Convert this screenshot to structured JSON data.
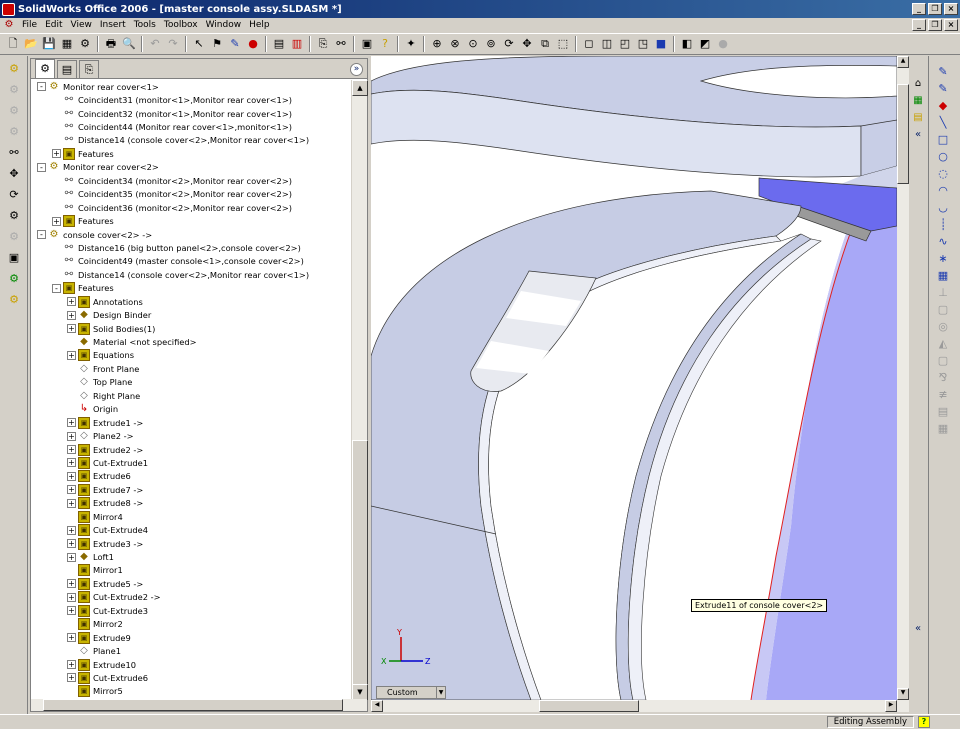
{
  "window": {
    "title": "SolidWorks Office 2006 - [master console assy.SLDASM *]"
  },
  "menu": [
    "File",
    "Edit",
    "View",
    "Insert",
    "Tools",
    "Toolbox",
    "Window",
    "Help"
  ],
  "tree": [
    {
      "label": "Monitor rear cover<1>",
      "indent": 0,
      "expander": "-",
      "icon": "comp"
    },
    {
      "label": "Coincident31 (monitor<1>,Monitor rear cover<1>)",
      "indent": 1,
      "icon": "mate"
    },
    {
      "label": "Coincident32 (monitor<1>,Monitor rear cover<1>)",
      "indent": 1,
      "icon": "mate"
    },
    {
      "label": "Coincident44 (Monitor rear cover<1>,monitor<1>)",
      "indent": 1,
      "icon": "mate"
    },
    {
      "label": "Distance14 (console cover<2>,Monitor rear cover<1>)",
      "indent": 1,
      "icon": "mate"
    },
    {
      "label": "Features",
      "indent": 1,
      "expander": "+",
      "icon": "feat"
    },
    {
      "label": "Monitor rear cover<2>",
      "indent": 0,
      "expander": "-",
      "icon": "comp"
    },
    {
      "label": "Coincident34 (monitor<2>,Monitor rear cover<2>)",
      "indent": 1,
      "icon": "mate"
    },
    {
      "label": "Coincident35 (monitor<2>,Monitor rear cover<2>)",
      "indent": 1,
      "icon": "mate"
    },
    {
      "label": "Coincident36 (monitor<2>,Monitor rear cover<2>)",
      "indent": 1,
      "icon": "mate"
    },
    {
      "label": "Features",
      "indent": 1,
      "expander": "+",
      "icon": "feat"
    },
    {
      "label": "console cover<2> ->",
      "indent": 0,
      "expander": "-",
      "icon": "comp"
    },
    {
      "label": "Distance16 (big button panel<2>,console cover<2>)",
      "indent": 1,
      "icon": "mate"
    },
    {
      "label": "Coincident49 (master console<1>,console cover<2>)",
      "indent": 1,
      "icon": "mate"
    },
    {
      "label": "Distance14 (console cover<2>,Monitor rear cover<1>)",
      "indent": 1,
      "icon": "mate"
    },
    {
      "label": "Features",
      "indent": 1,
      "expander": "-",
      "icon": "feat"
    },
    {
      "label": "Annotations",
      "indent": 2,
      "expander": "+",
      "icon": "feat"
    },
    {
      "label": "Design Binder",
      "indent": 2,
      "expander": "+",
      "icon": "body"
    },
    {
      "label": "Solid Bodies(1)",
      "indent": 2,
      "expander": "+",
      "icon": "feat"
    },
    {
      "label": "Material <not specified>",
      "indent": 2,
      "icon": "body"
    },
    {
      "label": "Equations",
      "indent": 2,
      "expander": "+",
      "icon": "feat"
    },
    {
      "label": "Front Plane",
      "indent": 2,
      "icon": "plane"
    },
    {
      "label": "Top Plane",
      "indent": 2,
      "icon": "plane"
    },
    {
      "label": "Right Plane",
      "indent": 2,
      "icon": "plane"
    },
    {
      "label": "Origin",
      "indent": 2,
      "icon": "origin"
    },
    {
      "label": "Extrude1 ->",
      "indent": 2,
      "expander": "+",
      "icon": "feat"
    },
    {
      "label": "Plane2 ->",
      "indent": 2,
      "expander": "+",
      "icon": "plane"
    },
    {
      "label": "Extrude2 ->",
      "indent": 2,
      "expander": "+",
      "icon": "feat"
    },
    {
      "label": "Cut-Extrude1",
      "indent": 2,
      "expander": "+",
      "icon": "feat"
    },
    {
      "label": "Extrude6",
      "indent": 2,
      "expander": "+",
      "icon": "feat"
    },
    {
      "label": "Extrude7 ->",
      "indent": 2,
      "expander": "+",
      "icon": "feat"
    },
    {
      "label": "Extrude8 ->",
      "indent": 2,
      "expander": "+",
      "icon": "feat"
    },
    {
      "label": "Mirror4",
      "indent": 2,
      "icon": "feat"
    },
    {
      "label": "Cut-Extrude4",
      "indent": 2,
      "expander": "+",
      "icon": "feat"
    },
    {
      "label": "Extrude3 ->",
      "indent": 2,
      "expander": "+",
      "icon": "feat"
    },
    {
      "label": "Loft1",
      "indent": 2,
      "expander": "+",
      "icon": "body"
    },
    {
      "label": "Mirror1",
      "indent": 2,
      "icon": "feat"
    },
    {
      "label": "Extrude5 ->",
      "indent": 2,
      "expander": "+",
      "icon": "feat"
    },
    {
      "label": "Cut-Extrude2 ->",
      "indent": 2,
      "expander": "+",
      "icon": "feat"
    },
    {
      "label": "Cut-Extrude3",
      "indent": 2,
      "expander": "+",
      "icon": "feat"
    },
    {
      "label": "Mirror2",
      "indent": 2,
      "icon": "feat"
    },
    {
      "label": "Extrude9",
      "indent": 2,
      "expander": "+",
      "icon": "feat"
    },
    {
      "label": "Plane1",
      "indent": 2,
      "icon": "plane"
    },
    {
      "label": "Extrude10",
      "indent": 2,
      "expander": "+",
      "icon": "feat"
    },
    {
      "label": "Cut-Extrude6",
      "indent": 2,
      "expander": "+",
      "icon": "feat"
    },
    {
      "label": "Mirror5",
      "indent": 2,
      "icon": "feat"
    }
  ],
  "graphics": {
    "tooltip": "Extrude11 of console cover<2>",
    "view_tab": "Custom",
    "triad": {
      "x_label": "X",
      "y_label": "Y",
      "z_label": "Z"
    }
  },
  "status": {
    "mode": "Editing Assembly",
    "help": "?"
  },
  "colors": {
    "title_start": "#0a246a",
    "title_end": "#3a6ea5",
    "part_gray": "#c6cce4",
    "part_light": "#dde2f1",
    "part_blue": "#6b6bee",
    "edge_red": "#e02020"
  }
}
